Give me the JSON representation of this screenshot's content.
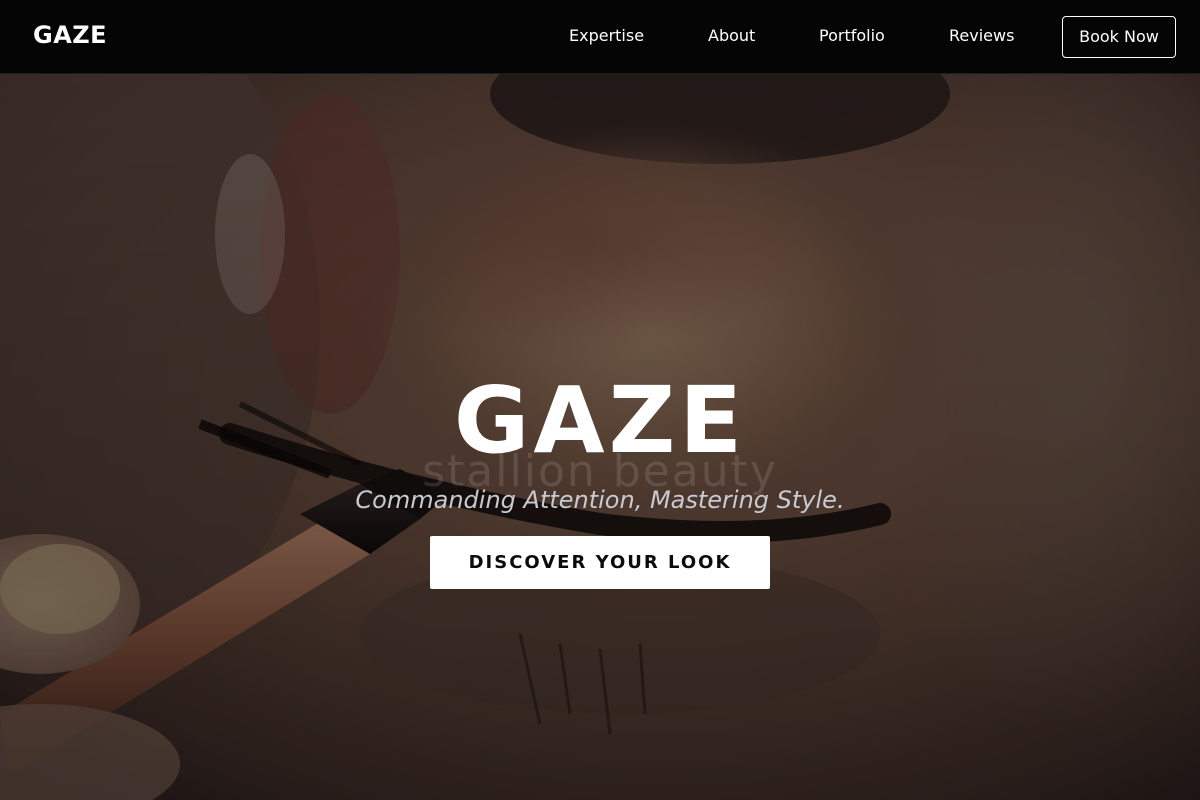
{
  "header": {
    "logo": "GAZE",
    "nav": {
      "expertise": "Expertise",
      "about": "About",
      "portfolio": "Portfolio",
      "reviews": "Reviews"
    },
    "book_button": "Book Now"
  },
  "hero": {
    "title": "GAZE",
    "watermark": "stallion beauty",
    "subtitle": "Commanding Attention, Mastering Style.",
    "cta_label": "DISCOVER YOUR LOOK"
  },
  "colors": {
    "header_background": "#050505",
    "text_primary": "#ffffff",
    "subtitle_text": "#c9c9d2",
    "cta_background": "#ffffff",
    "cta_text": "#0b0b0b",
    "hero_skin_tone": "#8a6650",
    "brush_handle": "#b07a5e"
  },
  "icons": {
    "hero_image": "eye-makeup-photo"
  }
}
